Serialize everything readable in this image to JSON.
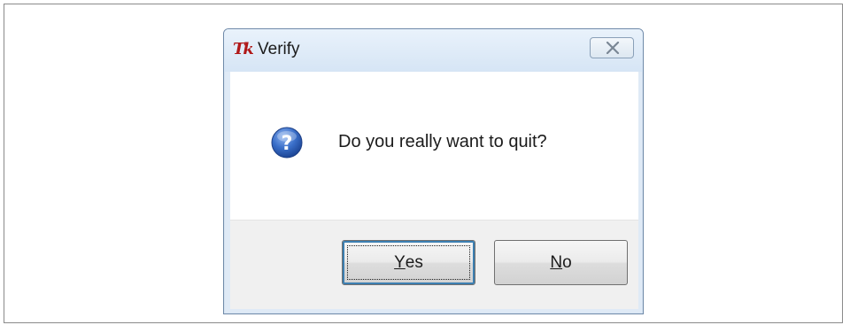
{
  "dialog": {
    "title": "Verify",
    "app_icon_text": "Tk",
    "message": "Do you really want to quit?",
    "icons": {
      "app": "tk-feather-icon",
      "message": "question-icon",
      "close": "close-icon"
    },
    "buttons": {
      "yes": {
        "accel": "Y",
        "rest": "es"
      },
      "no": {
        "accel": "N",
        "rest": "o"
      }
    }
  },
  "colors": {
    "accent": "#3c7fb1",
    "question_icon": "#2f62b8",
    "app_icon": "#b01818"
  }
}
